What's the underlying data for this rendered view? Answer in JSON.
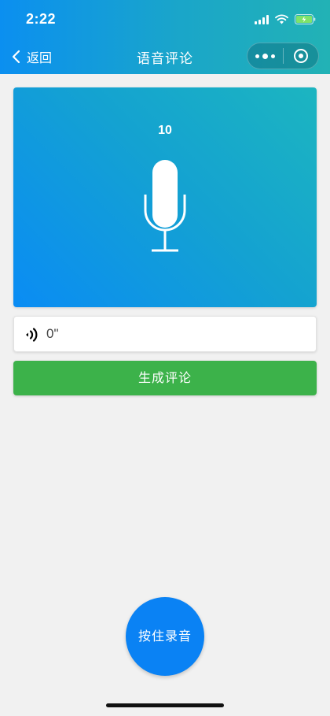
{
  "status_bar": {
    "time": "2:22"
  },
  "nav": {
    "back_label": "返回",
    "title": "语音评论"
  },
  "recorder": {
    "countdown": "10",
    "duration": "0\""
  },
  "actions": {
    "generate_label": "生成评论",
    "record_label": "按住录音"
  },
  "colors": {
    "header_gradient": [
      "#0b8ff0",
      "#22b2b5"
    ],
    "card_gradient": [
      "#0a8cf4",
      "#1cb5c0"
    ],
    "generate_button": "#3cb24a",
    "record_button": "#0a82f4",
    "background": "#f1f1f1"
  },
  "icons": {
    "status": [
      "signal-icon",
      "wifi-icon",
      "battery-icon"
    ],
    "nav": [
      "back-chevron-icon",
      "more-dots-icon",
      "close-target-icon"
    ],
    "content": [
      "microphone-icon",
      "speaker-icon"
    ]
  }
}
